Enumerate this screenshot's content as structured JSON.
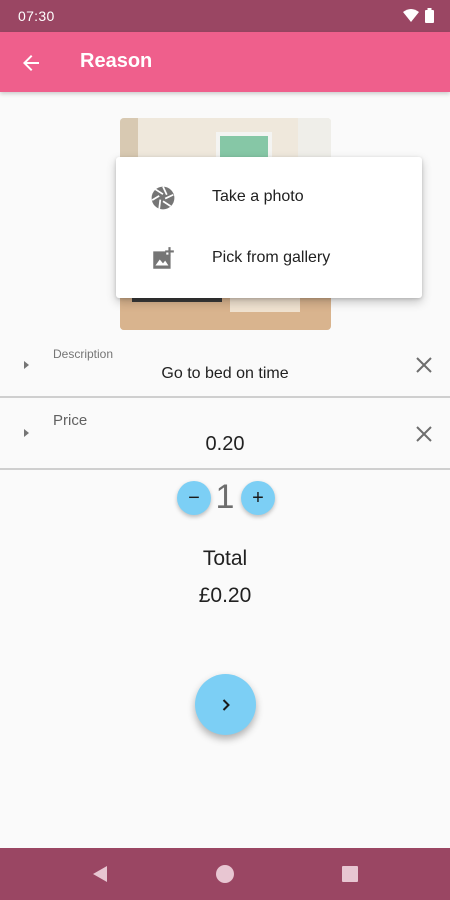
{
  "status_bar": {
    "time": "07:30",
    "wifi_icon": "wifi-icon",
    "battery_icon": "battery-icon"
  },
  "app_bar": {
    "title": "Reason",
    "back_icon": "arrow-back-icon"
  },
  "photo_menu": {
    "items": [
      {
        "label": "Take a photo",
        "icon": "camera-shutter-icon"
      },
      {
        "label": "Pick from gallery",
        "icon": "add-photo-icon"
      }
    ]
  },
  "description": {
    "label": "Description",
    "value": "Go to bed on time"
  },
  "price": {
    "label": "Price",
    "value": "0.20"
  },
  "quantity": {
    "value": "1",
    "decrement": "−",
    "increment": "+"
  },
  "total": {
    "label": "Total",
    "value": "£0.20"
  },
  "colors": {
    "app_bar": "#ef5f8c",
    "status_bar": "#9a4663",
    "accent": "#7ccff5"
  }
}
